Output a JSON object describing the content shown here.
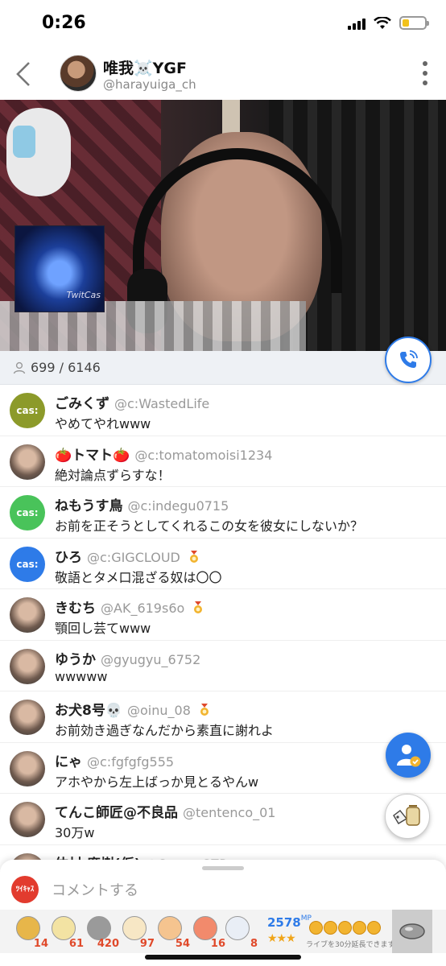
{
  "status": {
    "time": "0:26"
  },
  "header": {
    "name": "唯我☠️YGF",
    "handle": "@harayuiga_ch"
  },
  "video": {
    "overlay_label": "TwitCas"
  },
  "viewers": {
    "count": "699 / 6146"
  },
  "comments": [
    {
      "name": "ごみくず",
      "handle": "@c:WastedLife",
      "text": "やめてやれwww",
      "avatar": "cas",
      "avatar_color": "#8c9a2a",
      "badge": false
    },
    {
      "name": "🍅トマト🍅",
      "handle": "@c:tomatomoisi1234",
      "text": "絶対論点ずらすな！",
      "avatar": "photo",
      "badge": false
    },
    {
      "name": "ねもうす鳥",
      "handle": "@c:indegu0715",
      "text": "お前を正そうとしてくれるこの女を彼女にしないか？",
      "avatar": "cas",
      "avatar_color": "#49c35a",
      "badge": false
    },
    {
      "name": "ひろ",
      "handle": "@c:GIGCLOUD",
      "text": "敬語とタメ口混ざる奴は〇〇",
      "avatar": "cas",
      "avatar_color": "#2e7be8",
      "badge": true
    },
    {
      "name": "きむち",
      "handle": "@AK_619s6o",
      "text": "顎回し芸てwww",
      "avatar": "photo",
      "badge": true
    },
    {
      "name": "ゆうか",
      "handle": "@gyugyu_6752",
      "text": "wwwww",
      "avatar": "photo",
      "badge": false
    },
    {
      "name": "お犬8号💀",
      "handle": "@oinu_08",
      "text": "お前効き過ぎなんだから素直に謝れよ",
      "avatar": "photo",
      "badge": true
    },
    {
      "name": "にゃ",
      "handle": "@c:fgfgfg555",
      "text": "アホやから左上ばっか見とるやんw",
      "avatar": "photo",
      "badge": false
    },
    {
      "name": "てんこ師匠@不良品",
      "handle": "@tentenco_01",
      "text": "30万w",
      "avatar": "photo",
      "badge": false
    },
    {
      "name": "仲村 廣樹(仮)",
      "handle": "@Supra_SZP",
      "text": "",
      "avatar": "photo",
      "badge": false
    }
  ],
  "composer": {
    "placeholder": "コメントする",
    "logo_text": "ﾂｲｷｬｽ"
  },
  "items": [
    {
      "name": "wreath-item",
      "count": "14",
      "color": "#e7b64a"
    },
    {
      "name": "tea-item",
      "count": "61",
      "color": "#f3e3a3"
    },
    {
      "name": "stone-item",
      "count": "420",
      "color": "#9a9a9a"
    },
    {
      "name": "jar-item",
      "count": "97",
      "color": "#f7e7c5"
    },
    {
      "name": "clap-item",
      "count": "54",
      "color": "#f5c48f"
    },
    {
      "name": "peach-item",
      "count": "16",
      "color": "#f28a6c"
    },
    {
      "name": "ghost-item",
      "count": "8",
      "color": "#e9eef6"
    }
  ],
  "points": {
    "value": "2578",
    "unit": "MP",
    "stars": "★★★",
    "extend_text": "ライブを30分延長できます。"
  },
  "colors": {
    "accent": "#2e7be8",
    "count_red": "#e0492a"
  }
}
